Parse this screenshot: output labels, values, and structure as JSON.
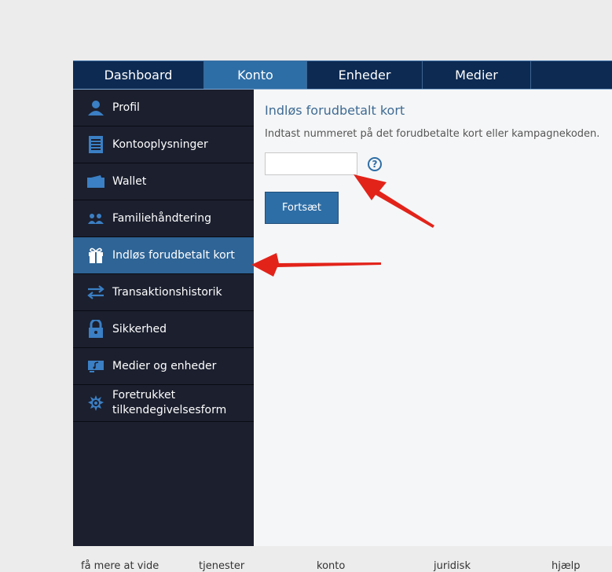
{
  "topnav": {
    "tabs": [
      {
        "label": "Dashboard"
      },
      {
        "label": "Konto"
      },
      {
        "label": "Enheder"
      },
      {
        "label": "Medier"
      }
    ]
  },
  "sidebar": {
    "items": [
      {
        "label": "Profil",
        "icon": "person-icon"
      },
      {
        "label": "Kontooplysninger",
        "icon": "document-icon"
      },
      {
        "label": "Wallet",
        "icon": "wallet-icon"
      },
      {
        "label": "Familiehåndtering",
        "icon": "family-icon"
      },
      {
        "label": "Indløs forudbetalt kort",
        "icon": "gift-icon",
        "active": true
      },
      {
        "label": "Transaktionshistorik",
        "icon": "transfer-arrows-icon"
      },
      {
        "label": "Sikkerhed",
        "icon": "lock-icon"
      },
      {
        "label": "Medier og enheder",
        "icon": "media-icon"
      },
      {
        "label": "Foretrukket tilkendegivelsesform",
        "icon": "badge-icon"
      }
    ]
  },
  "main": {
    "title": "Indløs forudbetalt kort",
    "instructions": "Indtast nummeret på det forudbetalte kort eller kampagnekoden.",
    "code_input": {
      "value": "",
      "placeholder": ""
    },
    "help_label": "?",
    "continue_label": "Fortsæt"
  },
  "footer": {
    "links": [
      "få mere at vide",
      "tjenester",
      "konto",
      "juridisk",
      "hjælp"
    ]
  },
  "colors": {
    "nav_bg": "#0d2a52",
    "active_tab": "#2e6ea6",
    "sidebar_bg": "#1b1f2e",
    "sidebar_active": "#2e6496",
    "accent": "#2e6ea6",
    "annotation_arrow": "#e2231a"
  }
}
